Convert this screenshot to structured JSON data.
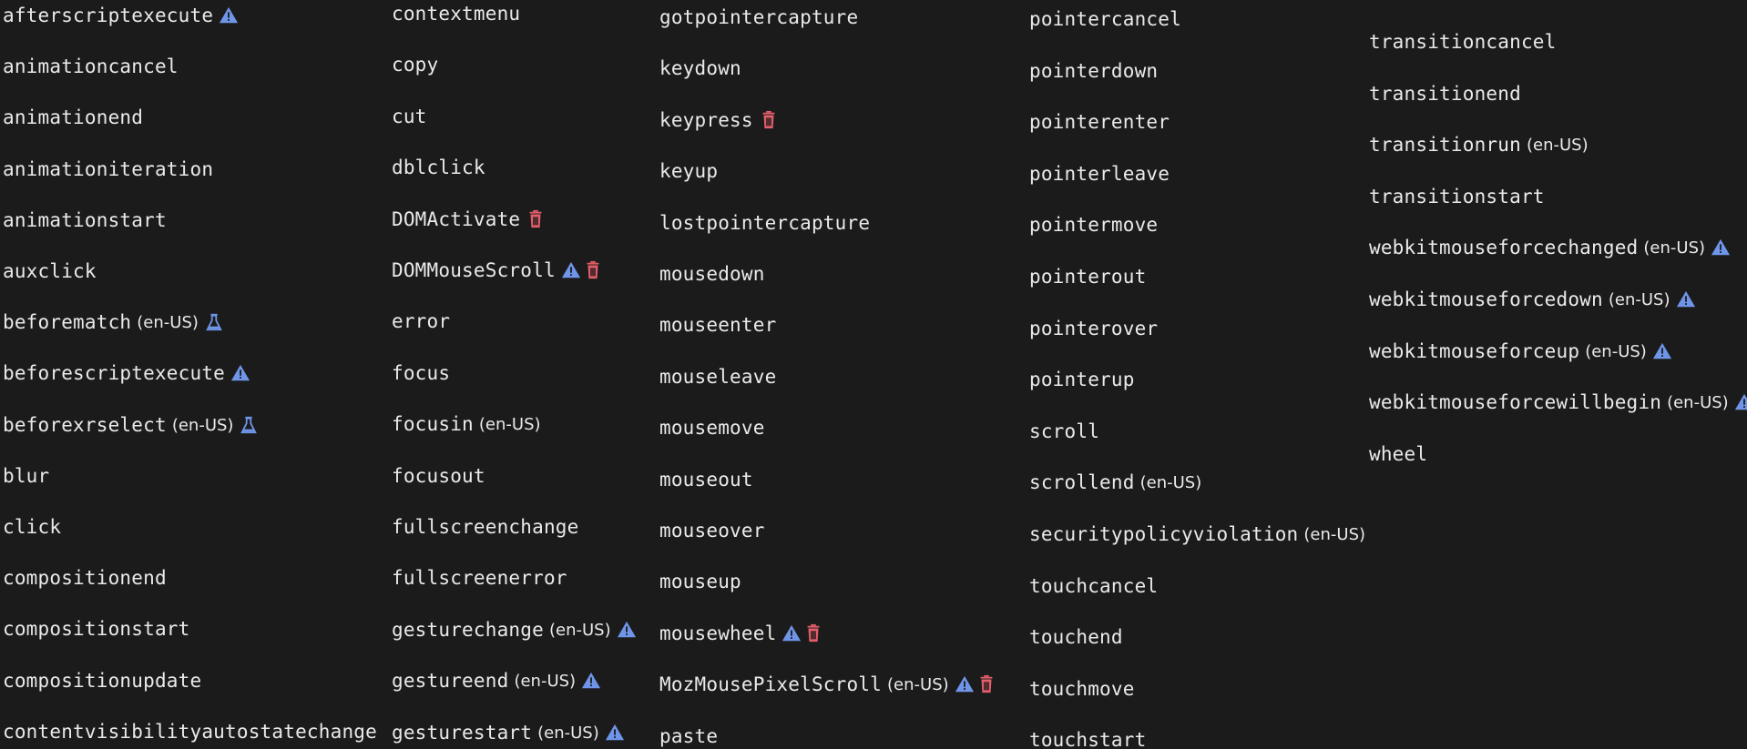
{
  "columns": [
    {
      "items": [
        {
          "name": "afterscriptexecute",
          "locale": "",
          "icons": [
            "warning-icon"
          ]
        },
        {
          "name": "animationcancel",
          "locale": "",
          "icons": []
        },
        {
          "name": "animationend",
          "locale": "",
          "icons": []
        },
        {
          "name": "animationiteration",
          "locale": "",
          "icons": []
        },
        {
          "name": "animationstart",
          "locale": "",
          "icons": []
        },
        {
          "name": "auxclick",
          "locale": "",
          "icons": []
        },
        {
          "name": "beforematch",
          "locale": "(en-US)",
          "icons": [
            "flask-icon"
          ]
        },
        {
          "name": "beforescriptexecute",
          "locale": "",
          "icons": [
            "warning-icon"
          ]
        },
        {
          "name": "beforexrselect",
          "locale": "(en-US)",
          "icons": [
            "flask-icon"
          ]
        },
        {
          "name": "blur",
          "locale": "",
          "icons": []
        },
        {
          "name": "click",
          "locale": "",
          "icons": []
        },
        {
          "name": "compositionend",
          "locale": "",
          "icons": []
        },
        {
          "name": "compositionstart",
          "locale": "",
          "icons": []
        },
        {
          "name": "compositionupdate",
          "locale": "",
          "icons": []
        },
        {
          "name": "contentvisibilityautostatechange",
          "locale": "",
          "icons": []
        }
      ]
    },
    {
      "items": [
        {
          "name": "contextmenu",
          "locale": "",
          "icons": []
        },
        {
          "name": "copy",
          "locale": "",
          "icons": []
        },
        {
          "name": "cut",
          "locale": "",
          "icons": []
        },
        {
          "name": "dblclick",
          "locale": "",
          "icons": []
        },
        {
          "name": "DOMActivate",
          "locale": "",
          "icons": [
            "trash-icon"
          ]
        },
        {
          "name": "DOMMouseScroll",
          "locale": "",
          "icons": [
            "warning-icon",
            "trash-icon"
          ]
        },
        {
          "name": "error",
          "locale": "",
          "icons": []
        },
        {
          "name": "focus",
          "locale": "",
          "icons": []
        },
        {
          "name": "focusin",
          "locale": "(en-US)",
          "icons": []
        },
        {
          "name": "focusout",
          "locale": "",
          "icons": []
        },
        {
          "name": "fullscreenchange",
          "locale": "",
          "icons": []
        },
        {
          "name": "fullscreenerror",
          "locale": "",
          "icons": []
        },
        {
          "name": "gesturechange",
          "locale": "(en-US)",
          "icons": [
            "warning-icon"
          ]
        },
        {
          "name": "gestureend",
          "locale": "(en-US)",
          "icons": [
            "warning-icon"
          ]
        },
        {
          "name": "gesturestart",
          "locale": "(en-US)",
          "icons": [
            "warning-icon"
          ]
        }
      ]
    },
    {
      "items": [
        {
          "name": "gotpointercapture",
          "locale": "",
          "icons": []
        },
        {
          "name": "keydown",
          "locale": "",
          "icons": []
        },
        {
          "name": "keypress",
          "locale": "",
          "icons": [
            "trash-icon"
          ]
        },
        {
          "name": "keyup",
          "locale": "",
          "icons": []
        },
        {
          "name": "lostpointercapture",
          "locale": "",
          "icons": []
        },
        {
          "name": "mousedown",
          "locale": "",
          "icons": []
        },
        {
          "name": "mouseenter",
          "locale": "",
          "icons": []
        },
        {
          "name": "mouseleave",
          "locale": "",
          "icons": []
        },
        {
          "name": "mousemove",
          "locale": "",
          "icons": []
        },
        {
          "name": "mouseout",
          "locale": "",
          "icons": []
        },
        {
          "name": "mouseover",
          "locale": "",
          "icons": []
        },
        {
          "name": "mouseup",
          "locale": "",
          "icons": []
        },
        {
          "name": "mousewheel",
          "locale": "",
          "icons": [
            "warning-icon",
            "trash-icon"
          ]
        },
        {
          "name": "MozMousePixelScroll",
          "locale": "(en-US)",
          "icons": [
            "warning-icon",
            "trash-icon"
          ]
        },
        {
          "name": "paste",
          "locale": "",
          "icons": []
        }
      ]
    },
    {
      "items": [
        {
          "name": "pointercancel",
          "locale": "",
          "icons": []
        },
        {
          "name": "pointerdown",
          "locale": "",
          "icons": []
        },
        {
          "name": "pointerenter",
          "locale": "",
          "icons": []
        },
        {
          "name": "pointerleave",
          "locale": "",
          "icons": []
        },
        {
          "name": "pointermove",
          "locale": "",
          "icons": []
        },
        {
          "name": "pointerout",
          "locale": "",
          "icons": []
        },
        {
          "name": "pointerover",
          "locale": "",
          "icons": []
        },
        {
          "name": "pointerup",
          "locale": "",
          "icons": []
        },
        {
          "name": "scroll",
          "locale": "",
          "icons": []
        },
        {
          "name": "scrollend",
          "locale": "(en-US)",
          "icons": []
        },
        {
          "name": "securitypolicyviolation",
          "locale": "(en-US)",
          "icons": []
        },
        {
          "name": "touchcancel",
          "locale": "",
          "icons": []
        },
        {
          "name": "touchend",
          "locale": "",
          "icons": []
        },
        {
          "name": "touchmove",
          "locale": "",
          "icons": []
        },
        {
          "name": "touchstart",
          "locale": "",
          "icons": []
        }
      ]
    },
    {
      "items": [
        {
          "name": "transitioncancel",
          "locale": "",
          "icons": []
        },
        {
          "name": "transitionend",
          "locale": "",
          "icons": []
        },
        {
          "name": "transitionrun",
          "locale": "(en-US)",
          "icons": []
        },
        {
          "name": "transitionstart",
          "locale": "",
          "icons": []
        },
        {
          "name": "webkitmouseforcechanged",
          "locale": "(en-US)",
          "icons": [
            "warning-icon"
          ]
        },
        {
          "name": "webkitmouseforcedown",
          "locale": "(en-US)",
          "icons": [
            "warning-icon"
          ]
        },
        {
          "name": "webkitmouseforceup",
          "locale": "(en-US)",
          "icons": [
            "warning-icon"
          ]
        },
        {
          "name": "webkitmouseforcewillbegin",
          "locale": "(en-US)",
          "icons": [
            "warning-icon"
          ]
        },
        {
          "name": "wheel",
          "locale": "",
          "icons": []
        }
      ]
    }
  ],
  "colors": {
    "background": "#1b1b1b",
    "text": "#eaeaea",
    "warning": "#6f95e8",
    "trash": "#e35d6a",
    "flask": "#6f95e8"
  }
}
